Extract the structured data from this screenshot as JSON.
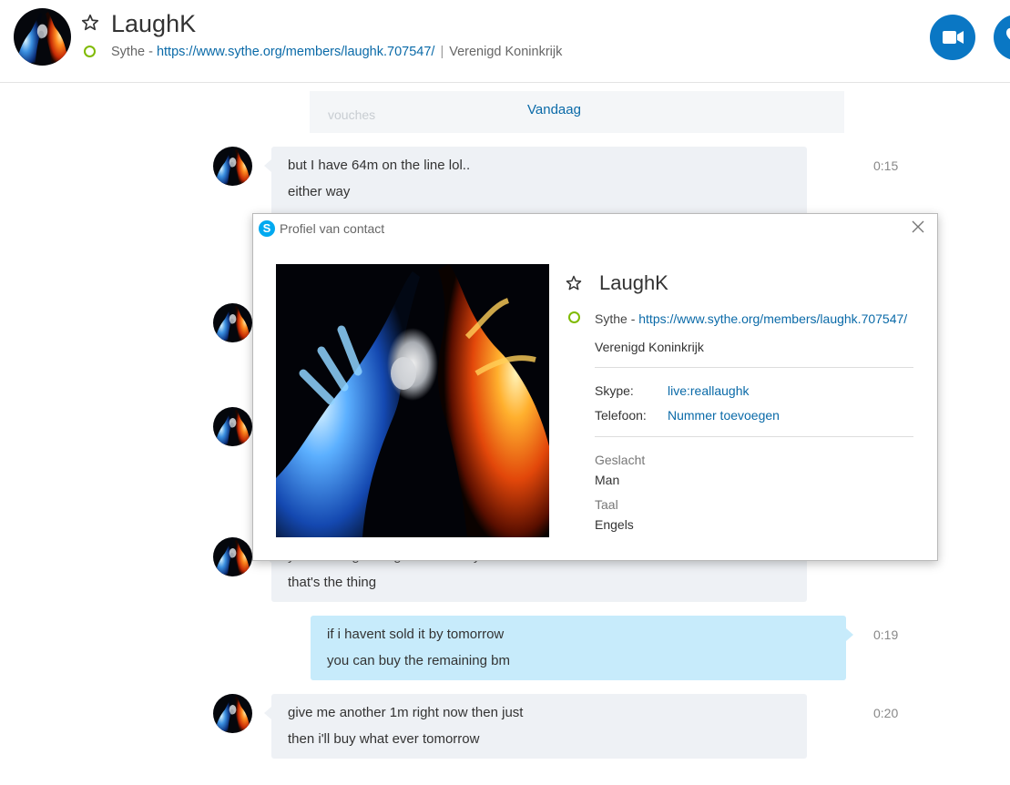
{
  "header": {
    "name": "LaughK",
    "mood_prefix": "Sythe - ",
    "mood_link": "https://www.sythe.org/members/laughk.707547/",
    "separator": "|",
    "location": "Verenigd Koninkrijk",
    "buttons": [
      "video-call-icon",
      "heart-icon"
    ]
  },
  "conversation": {
    "faded_text": "vouches",
    "date_divider": "Vandaag",
    "messages": [
      {
        "direction": "in",
        "lines": [
          "but I have 64m on the line lol..",
          "either way"
        ],
        "time": "0:15"
      },
      {
        "direction": "in",
        "lines": [
          "that's the thing"
        ],
        "partial_top_text": "you're still gonna get the money",
        "time": ""
      },
      {
        "direction": "out",
        "lines": [
          "if i havent sold it by tomorrow",
          "you can buy the remaining bm"
        ],
        "time": "0:19"
      },
      {
        "direction": "in",
        "lines": [
          "give me another 1m right now then just",
          "then i'll buy what ever tomorrow"
        ],
        "time": "0:20"
      }
    ]
  },
  "profile_dialog": {
    "title": "Profiel van contact",
    "name": "LaughK",
    "mood_prefix": "Sythe - ",
    "mood_link": "https://www.sythe.org/members/laughk.707547/",
    "country": "Verenigd Koninkrijk",
    "skype_label": "Skype:",
    "skype_value": "live:reallaughk",
    "phone_label": "Telefoon:",
    "phone_value": "Nummer toevoegen",
    "gender_label": "Geslacht",
    "gender_value": "Man",
    "language_label": "Taal",
    "language_value": "Engels"
  },
  "colors": {
    "accent": "#0a6aa8",
    "button": "#0a77c4",
    "presence": "#7fba00",
    "bubble_in": "#eef1f5",
    "bubble_out": "#c7ebfb"
  }
}
